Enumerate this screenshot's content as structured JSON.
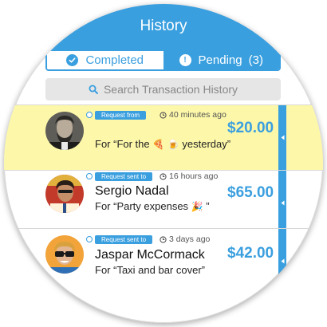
{
  "header": {
    "title": "History"
  },
  "tabs": {
    "completed": {
      "label": "Completed",
      "icon": "check-icon"
    },
    "pending": {
      "label": "Pending",
      "count": "(3)",
      "icon": "exclamation-icon"
    }
  },
  "search": {
    "placeholder": "Search Transaction History",
    "icon": "search-icon"
  },
  "colors": {
    "accent": "#3a9fdf",
    "highlight": "#fdf8a9"
  },
  "transactions": [
    {
      "tag": "Request from",
      "time": "40 minutes ago",
      "name": "",
      "note_prefix": "For “For the",
      "note_emoji_1": "🍕",
      "note_emoji_2": "🍺",
      "note_suffix": "yesterday”",
      "amount": "$20.00"
    },
    {
      "tag": "Request sent to",
      "time": "16 hours ago",
      "name": "Sergio Nadal",
      "note_prefix": "For “Party expenses",
      "note_emoji_1": "🎉",
      "note_suffix": "”",
      "amount": "$65.00"
    },
    {
      "tag": "Request sent to",
      "time": "3 days ago",
      "name": "Jaspar McCormack",
      "note": "For “Taxi and bar cover”",
      "amount": "$42.00"
    }
  ]
}
